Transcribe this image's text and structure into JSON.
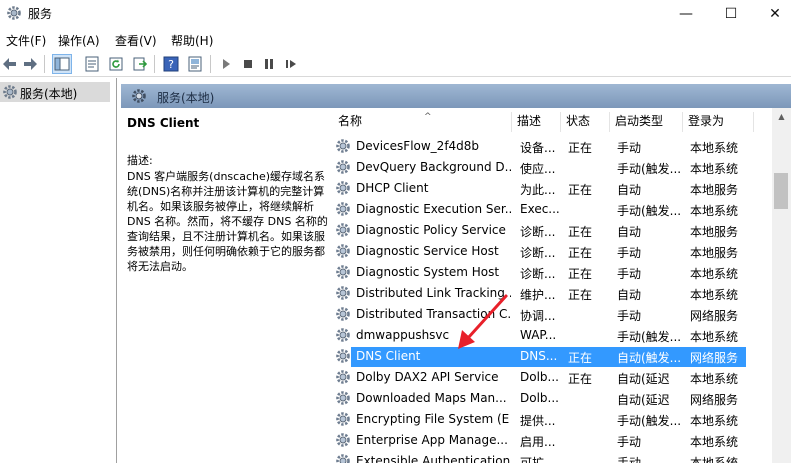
{
  "window": {
    "title": "服务",
    "minimize_glyph": "—",
    "maximize_glyph": "☐",
    "close_glyph": "✕"
  },
  "menu": [
    {
      "label": "文件(F)"
    },
    {
      "label": "操作(A)"
    },
    {
      "label": "查看(V)"
    },
    {
      "label": "帮助(H)"
    }
  ],
  "tree": {
    "root_label": "服务(本地)"
  },
  "pane": {
    "header_label": "服务(本地)",
    "selected_service": "DNS Client",
    "description_label": "描述:",
    "description_text": "DNS 客户端服务(dnscache)缓存域名系统(DNS)名称并注册该计算机的完整计算机名。如果该服务被停止，将继续解析 DNS 名称。然而，将不缓存 DNS 名称的查询结果，且不注册计算机名。如果该服务被禁用，则任何明确依赖于它的服务都将无法启动。"
  },
  "table": {
    "columns": {
      "name": "名称",
      "desc": "描述",
      "status": "状态",
      "startup": "启动类型",
      "logon": "登录为"
    },
    "sort_caret": "^",
    "rows": [
      {
        "name": "DevicesFlow_2f4d8b",
        "desc": "设备...",
        "status": "正在",
        "startup": "手动",
        "logon": "本地系统"
      },
      {
        "name": "DevQuery Background D...",
        "desc": "使应...",
        "status": "",
        "startup": "手动(触发...",
        "logon": "本地系统"
      },
      {
        "name": "DHCP Client",
        "desc": "为此...",
        "status": "正在",
        "startup": "自动",
        "logon": "本地服务"
      },
      {
        "name": "Diagnostic Execution Ser...",
        "desc": "Exec...",
        "status": "",
        "startup": "手动(触发...",
        "logon": "本地系统"
      },
      {
        "name": "Diagnostic Policy Service",
        "desc": "诊断...",
        "status": "正在",
        "startup": "自动",
        "logon": "本地服务"
      },
      {
        "name": "Diagnostic Service Host",
        "desc": "诊断...",
        "status": "正在",
        "startup": "手动",
        "logon": "本地服务"
      },
      {
        "name": "Diagnostic System Host",
        "desc": "诊断...",
        "status": "正在",
        "startup": "手动",
        "logon": "本地系统"
      },
      {
        "name": "Distributed Link Tracking...",
        "desc": "维护...",
        "status": "正在",
        "startup": "自动",
        "logon": "本地系统"
      },
      {
        "name": "Distributed Transaction C...",
        "desc": "协调...",
        "status": "",
        "startup": "手动",
        "logon": "网络服务"
      },
      {
        "name": "dmwappushsvc",
        "desc": "WAP...",
        "status": "",
        "startup": "手动(触发...",
        "logon": "本地系统"
      },
      {
        "name": "DNS Client",
        "desc": "DNS...",
        "status": "正在",
        "startup": "自动(触发...",
        "logon": "网络服务",
        "selected": true
      },
      {
        "name": "Dolby DAX2 API Service",
        "desc": "Dolb...",
        "status": "正在",
        "startup": "自动(延迟",
        "logon": "本地系统"
      },
      {
        "name": "Downloaded Maps Man...",
        "desc": "Dolb...",
        "status": "",
        "startup": "自动(延迟",
        "logon": "网络服务"
      },
      {
        "name": "Encrypting File System (E",
        "desc": "提供...",
        "status": "",
        "startup": "手动(触发...",
        "logon": "本地系统"
      },
      {
        "name": "Enterprise App Manage...",
        "desc": "启用...",
        "status": "",
        "startup": "手动",
        "logon": "本地系统"
      },
      {
        "name": "Extensible Authentication...",
        "desc": "可扩...",
        "status": "",
        "startup": "手动",
        "logon": "本地系统"
      }
    ]
  },
  "colors": {
    "selection": "#3399ff",
    "pane_header": "#8aa4c4",
    "annotation_arrow": "#e8202a"
  },
  "icons": {
    "app": "services-gear-icon",
    "row": "service-gear-icon"
  }
}
